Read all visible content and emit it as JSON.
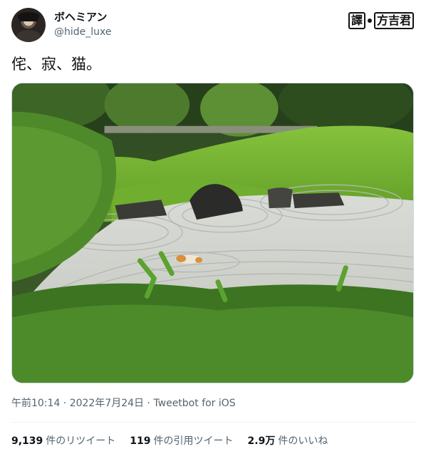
{
  "author": {
    "display_name": "ボヘミアン",
    "handle": "@hide_luxe",
    "avatar_icon": "avatar-photo"
  },
  "watermark": {
    "left": "譯",
    "right": "方吉君"
  },
  "tweet": {
    "text": "侘、寂、猫。",
    "image_icon": "zen-garden-cat-photo"
  },
  "meta": {
    "timestamp": "午前10:14 · 2022年7月24日 · Tweetbot for iOS"
  },
  "stats": [
    {
      "value": "9,139",
      "label": "件のリツイート"
    },
    {
      "value": "119",
      "label": "件の引用ツイート"
    },
    {
      "value": "2.9万",
      "label": "件のいいね"
    }
  ],
  "colors": {
    "text": "#0f1419",
    "secondary": "#536471",
    "border": "#cfd9de"
  }
}
